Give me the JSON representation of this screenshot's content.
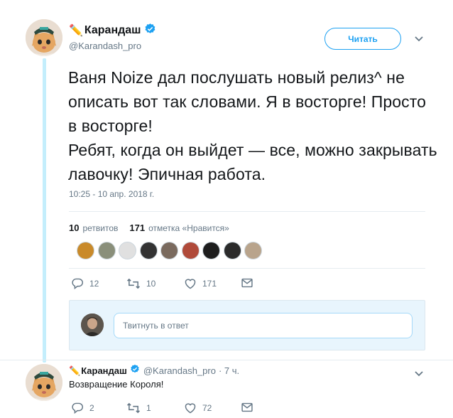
{
  "main_tweet": {
    "author": {
      "name_emoji": "✏️",
      "display_name": "Карандаш",
      "handle": "@Karandash_pro"
    },
    "follow_label": "Читать",
    "text": "Ваня Noize дал послушать новый релиз^ не описать вот так словами. Я в восторге! Просто в восторге!\nРебят, когда он выйдет — все, можно закрывать лавочку! Эпичная работа.",
    "timestamp": "10:25 - 10 апр. 2018 г.",
    "retweets": {
      "count": "10",
      "label": "ретвитов"
    },
    "likes": {
      "count": "171",
      "label": "отметка «Нравится»"
    },
    "actions": {
      "replies": "12",
      "retweets": "10",
      "likes": "171"
    },
    "liker_colors": [
      "#c98a2a",
      "#8a8f7a",
      "#e0e0e0",
      "#333333",
      "#7a6a5e",
      "#b04a3a",
      "#1e1e1e",
      "#2b2b2b",
      "#b9a48c"
    ]
  },
  "reply_box": {
    "placeholder": "Твитнуть в ответ"
  },
  "reply_tweet": {
    "author": {
      "name_emoji": "✏️",
      "display_name": "Карандаш",
      "handle": "@Karandash_pro"
    },
    "time": "· 7 ч.",
    "text": "Возвращение Короля!",
    "actions": {
      "replies": "2",
      "retweets": "1",
      "likes": "72"
    }
  },
  "colors": {
    "accent": "#1da1f2",
    "muted": "#657786",
    "thread_line": "#c4eefc"
  }
}
